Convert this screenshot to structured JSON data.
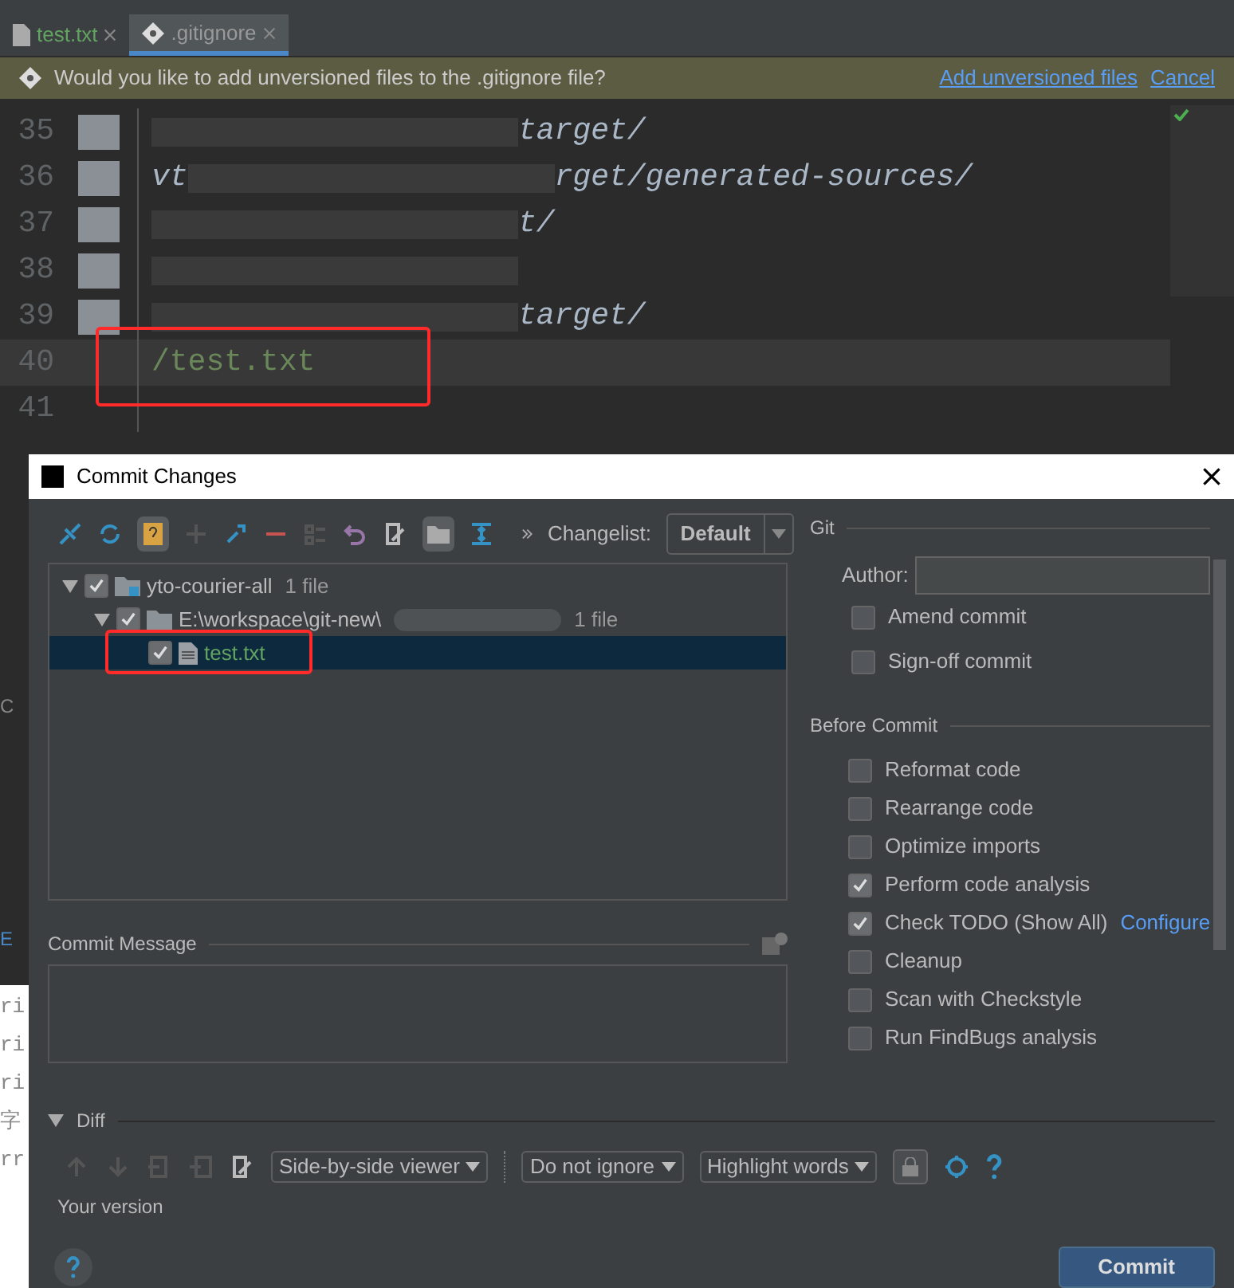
{
  "editor_tabs": [
    {
      "label": "test.txt",
      "kind": "text",
      "selected": false
    },
    {
      "label": ".gitignore",
      "kind": "git",
      "selected": true
    }
  ],
  "notification": {
    "message": "Would you like to add unversioned files to the .gitignore file?",
    "links": [
      "Add unversioned files",
      "Cancel"
    ]
  },
  "editor": {
    "lines": [
      {
        "number": "35",
        "folder": true,
        "current": false,
        "parts": [
          {
            "kind": "blur"
          },
          {
            "kind": "text",
            "text": "target/"
          }
        ]
      },
      {
        "number": "36",
        "folder": true,
        "current": false,
        "parts": [
          {
            "kind": "text",
            "text": "vt"
          },
          {
            "kind": "blur"
          },
          {
            "kind": "text",
            "text": "rget/generated-sources/"
          }
        ]
      },
      {
        "number": "37",
        "folder": true,
        "current": false,
        "parts": [
          {
            "kind": "blur"
          },
          {
            "kind": "text",
            "text": "t/"
          }
        ]
      },
      {
        "number": "38",
        "folder": true,
        "current": false,
        "parts": [
          {
            "kind": "blur"
          }
        ]
      },
      {
        "number": "39",
        "folder": true,
        "current": false,
        "parts": [
          {
            "kind": "blur"
          },
          {
            "kind": "text",
            "text": "target/"
          }
        ]
      },
      {
        "number": "40",
        "folder": false,
        "current": true,
        "parts": [
          {
            "kind": "added",
            "text": "/test.txt"
          }
        ]
      },
      {
        "number": "41",
        "folder": false,
        "current": false
      }
    ]
  },
  "background_fragments": [
    "C",
    "E",
    "ri",
    "ri",
    "ri",
    "字",
    "rr"
  ],
  "dialog": {
    "title": "Commit Changes",
    "changelist": {
      "label": "Changelist:",
      "value": "Default"
    },
    "tree": [
      {
        "name": "yto-courier-all",
        "count": "1 file",
        "checked": true,
        "expanded": true,
        "kind": "module",
        "children": [
          {
            "name": "E:\\workspace\\git-new\\",
            "count": "1 file",
            "checked": true,
            "expanded": true,
            "kind": "folder",
            "children": [
              {
                "name": "test.txt",
                "checked": true,
                "selected": true,
                "kind": "file"
              }
            ]
          }
        ]
      }
    ],
    "commit_message": {
      "label": "Commit Message"
    },
    "diff": {
      "label": "Diff",
      "expanded": true,
      "viewer": "Side-by-side viewer",
      "ignore": "Do not ignore",
      "highlight": "Highlight words",
      "version_label": "Your version"
    },
    "git": {
      "title": "Git",
      "author_label": "Author:",
      "options": [
        {
          "label": "Amend commit",
          "checked": false
        },
        {
          "label": "Sign-off commit",
          "checked": false
        }
      ]
    },
    "before_commit": {
      "title": "Before Commit",
      "options": [
        {
          "label": "Reformat code",
          "checked": false
        },
        {
          "label": "Rearrange code",
          "checked": false
        },
        {
          "label": "Optimize imports",
          "checked": false
        },
        {
          "label": "Perform code analysis",
          "checked": true
        },
        {
          "label": "Check TODO (Show All)",
          "checked": true,
          "link": "Configure"
        },
        {
          "label": "Cleanup",
          "checked": false
        },
        {
          "label": "Scan with Checkstyle",
          "checked": false
        },
        {
          "label": "Run FindBugs analysis",
          "checked": false
        }
      ]
    },
    "commit_button": "Commit"
  }
}
